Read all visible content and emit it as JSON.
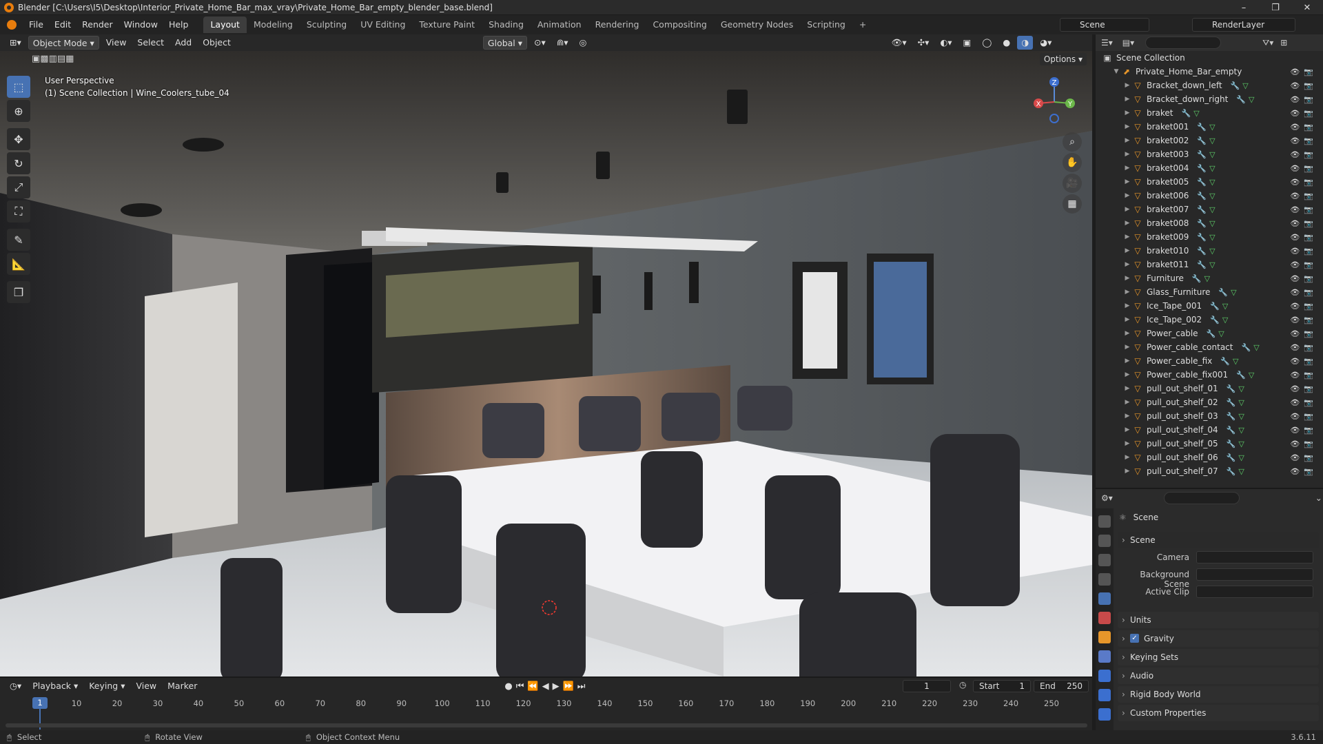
{
  "window": {
    "title": "Blender [C:\\Users\\I5\\Desktop\\Interior_Private_Home_Bar_max_vray\\Private_Home_Bar_empty_blender_base.blend]"
  },
  "menubar": {
    "menus": [
      "File",
      "Edit",
      "Render",
      "Window",
      "Help"
    ],
    "workspaces": [
      "Layout",
      "Modeling",
      "Sculpting",
      "UV Editing",
      "Texture Paint",
      "Shading",
      "Animation",
      "Rendering",
      "Compositing",
      "Geometry Nodes",
      "Scripting"
    ],
    "active_workspace": "Layout",
    "add_tab": "+",
    "scene_name": "Scene",
    "view_layer": "RenderLayer"
  },
  "viewport": {
    "mode": "Object Mode",
    "menus": [
      "View",
      "Select",
      "Add",
      "Object"
    ],
    "orientation": "Global",
    "options_label": "Options",
    "perspective_label": "User Perspective",
    "context_label": "(1) Scene Collection | Wine_Coolers_tube_04",
    "gizmo_axes": {
      "x": "X",
      "y": "Y",
      "z": "Z"
    }
  },
  "outliner": {
    "root": "Scene Collection",
    "collection": "Private_Home_Bar_empty",
    "items": [
      "Bracket_down_left",
      "Bracket_down_right",
      "braket",
      "braket001",
      "braket002",
      "braket003",
      "braket004",
      "braket005",
      "braket006",
      "braket007",
      "braket008",
      "braket009",
      "braket010",
      "braket011",
      "Furniture",
      "Glass_Furniture",
      "Ice_Tape_001",
      "Ice_Tape_002",
      "Power_cable",
      "Power_cable_contact",
      "Power_cable_fix",
      "Power_cable_fix001",
      "pull_out_shelf_01",
      "pull_out_shelf_02",
      "pull_out_shelf_03",
      "pull_out_shelf_04",
      "pull_out_shelf_05",
      "pull_out_shelf_06",
      "pull_out_shelf_07"
    ]
  },
  "properties": {
    "context_title": "Scene",
    "section_scene": "Scene",
    "camera_label": "Camera",
    "background_scene_label": "Background Scene",
    "active_clip_label": "Active Clip",
    "sections": [
      "Units",
      "Gravity",
      "Keying Sets",
      "Audio",
      "Rigid Body World",
      "Custom Properties"
    ],
    "gravity_checked": true
  },
  "timeline": {
    "menus": [
      "Playback",
      "Keying",
      "View",
      "Marker"
    ],
    "current_frame": "1",
    "start_label": "Start",
    "start_value": "1",
    "end_label": "End",
    "end_value": "250",
    "ticks": [
      "10",
      "20",
      "30",
      "40",
      "50",
      "60",
      "70",
      "80",
      "90",
      "100",
      "110",
      "120",
      "130",
      "140",
      "150",
      "160",
      "170",
      "180",
      "190",
      "200",
      "210",
      "220",
      "230",
      "240",
      "250"
    ]
  },
  "statusbar": {
    "select": "Select",
    "rotate": "Rotate View",
    "context_menu": "Object Context Menu",
    "version": "3.6.11"
  },
  "colors": {
    "accent": "#4772b3",
    "object_icon": "#e7962a",
    "modifier_icon": "#6ea1ff",
    "mesh_icon": "#5ed16a"
  }
}
